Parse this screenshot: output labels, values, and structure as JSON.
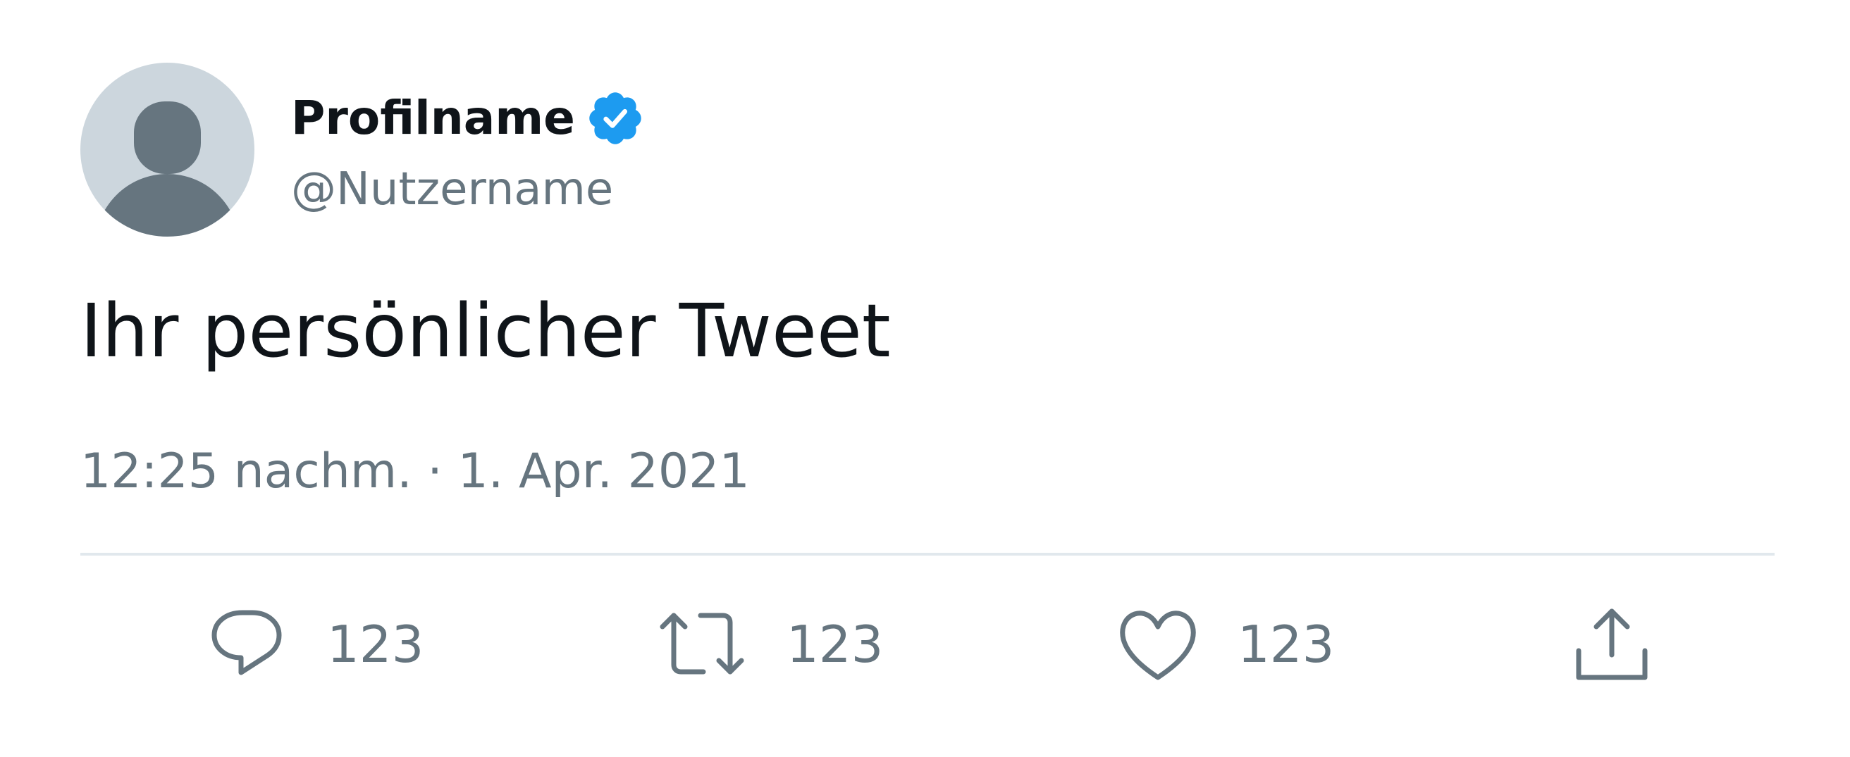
{
  "profile": {
    "name": "Profilname",
    "username": "@Nutzername",
    "verified": true
  },
  "tweet": {
    "text": "Ihr persönlicher Tweet",
    "timestamp": "12:25 nachm. · 1. Apr. 2021"
  },
  "actions": {
    "reply": {
      "icon": "speech-bubble-icon",
      "count": "123"
    },
    "retweet": {
      "icon": "retweet-arrows-icon",
      "count": "123"
    },
    "like": {
      "icon": "heart-icon",
      "count": "123"
    },
    "share": {
      "icon": "share-upload-icon"
    }
  },
  "colors": {
    "text_primary": "#0f1419",
    "text_secondary": "#66757f",
    "verified_blue": "#1d9bf0",
    "avatar_bg": "#ccd6dd",
    "avatar_figure": "#66757f",
    "divider": "#e1e8ed"
  }
}
